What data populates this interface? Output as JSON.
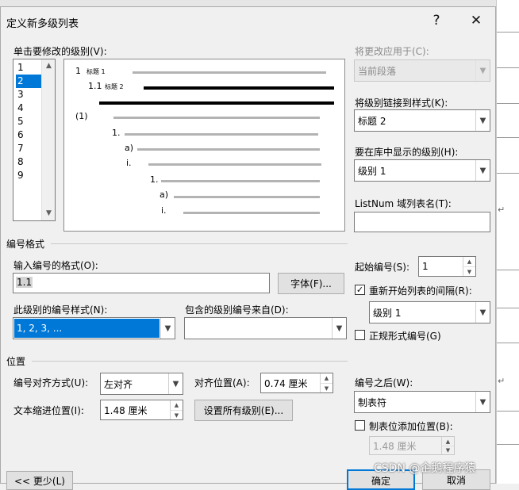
{
  "window": {
    "title": "定义新多级列表",
    "help_glyph": "?",
    "close_glyph": "✕"
  },
  "levels": {
    "label": "单击要修改的级别(V):",
    "items": [
      "1",
      "2",
      "3",
      "4",
      "5",
      "6",
      "7",
      "8",
      "9"
    ],
    "selected": "2"
  },
  "preview": {
    "lines": [
      {
        "num": "1",
        "caption": "标题 1"
      },
      {
        "num": "1.1",
        "caption": "标题 2"
      },
      {
        "num": "(1)",
        "caption": ""
      },
      {
        "num": "1.",
        "caption": ""
      },
      {
        "num": "a)",
        "caption": ""
      },
      {
        "num": "i.",
        "caption": ""
      },
      {
        "num": "1.",
        "caption": ""
      },
      {
        "num": "a)",
        "caption": ""
      },
      {
        "num": "i.",
        "caption": ""
      }
    ]
  },
  "right_panel": {
    "apply_to_label": "将更改应用于(C):",
    "apply_to_value": "当前段落",
    "link_style_label": "将级别链接到样式(K):",
    "link_style_value": "标题 2",
    "gallery_level_label": "要在库中显示的级别(H):",
    "gallery_level_value": "级别 1",
    "listnum_label": "ListNum 域列表名(T):",
    "listnum_value": ""
  },
  "number_format": {
    "section_label": "编号格式",
    "format_label": "输入编号的格式(O):",
    "format_value": "1.1",
    "font_button": "字体(F)...",
    "style_label": "此级别的编号样式(N):",
    "style_value": "1, 2, 3, ...",
    "include_label": "包含的级别编号来自(D):",
    "include_value": "",
    "start_at_label": "起始编号(S):",
    "start_at_value": "1",
    "restart_label": "重新开始列表的间隔(R):",
    "restart_checked": true,
    "restart_value": "级别 1",
    "legal_label": "正规形式编号(G)",
    "legal_checked": false
  },
  "position": {
    "section_label": "位置",
    "alignment_label": "编号对齐方式(U):",
    "alignment_value": "左对齐",
    "aligned_at_label": "对齐位置(A):",
    "aligned_at_value": "0.74 厘米",
    "indent_label": "文本缩进位置(I):",
    "indent_value": "1.48 厘米",
    "set_all_button": "设置所有级别(E)...",
    "follow_label": "编号之后(W):",
    "follow_value": "制表符",
    "tab_stop_label": "制表位添加位置(B):",
    "tab_stop_checked": false,
    "tab_stop_value": "1.48 厘米"
  },
  "footer": {
    "less_button": "<< 更少(L)",
    "ok_button": "确定",
    "cancel_button": "取消"
  },
  "watermark": "CSDN @企鹅程序猿",
  "colors": {
    "selection": "#0078d7",
    "dialog_bg": "#f0f0f0",
    "disabled_text": "#8a8a8a"
  }
}
